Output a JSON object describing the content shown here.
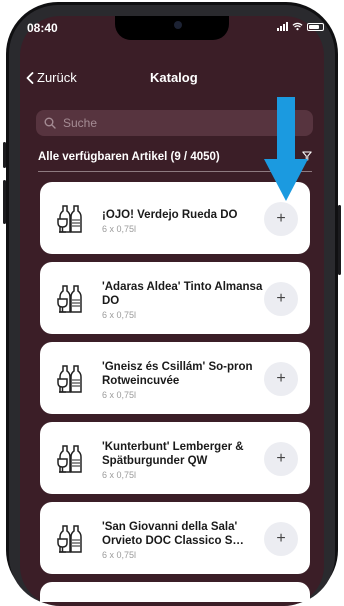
{
  "status": {
    "time": "08:40"
  },
  "nav": {
    "back_label": "Zurück",
    "title": "Katalog"
  },
  "search": {
    "placeholder": "Suche"
  },
  "list": {
    "header": "Alle verfügbaren Artikel (9 / 4050)"
  },
  "products": [
    {
      "name": "¡OJO! Verdejo Rueda DO",
      "size": "6 x 0,75l"
    },
    {
      "name": "'Adaras Aldea' Tinto Almansa DO",
      "size": "6 x 0,75l"
    },
    {
      "name": "'Gneisz és Csillám' So-pron Rotweincuvée",
      "size": "6 x 0,75l"
    },
    {
      "name": "'Kunterbunt' Lemberger & Spätburgunder QW",
      "size": "6 x 0,75l"
    },
    {
      "name": "'San Giovanni della Sala' Orvieto DOC Classico S…",
      "size": "6 x 0,75l"
    }
  ],
  "add_label": "+",
  "colors": {
    "background": "#3b1e27",
    "search_bg": "#57343f",
    "arrow": "#1b9ae0",
    "card": "#ffffff"
  },
  "icons": {
    "product": "wine-bottles-glass-icon",
    "filter": "filter-icon",
    "back": "chevron-left-icon",
    "search": "search-icon"
  }
}
